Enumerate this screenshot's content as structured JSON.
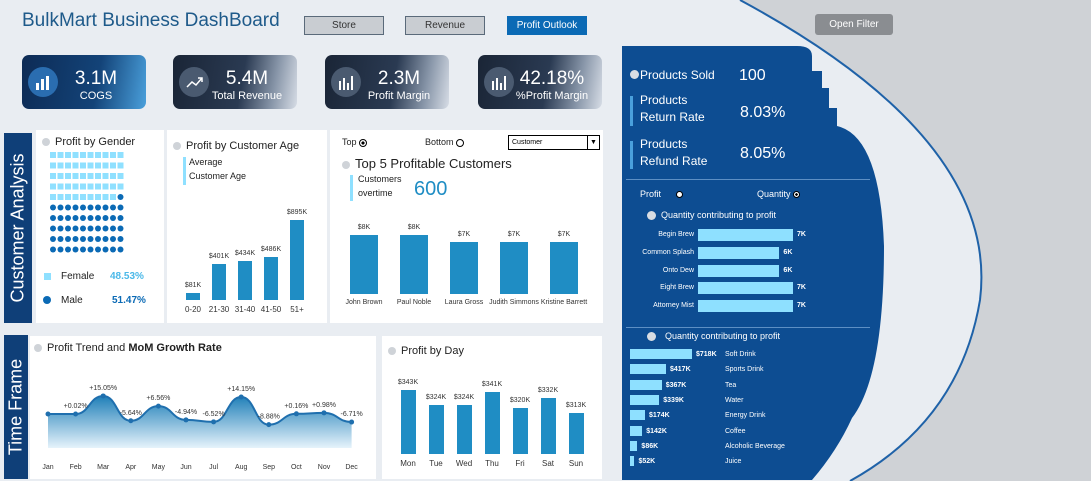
{
  "header": {
    "title": "BulkMart Business DashBoard",
    "tabs": [
      "Store",
      "Revenue",
      "Profit Outlook"
    ],
    "active_tab": "Profit Outlook",
    "open_filter": "Open Filter"
  },
  "kpis": [
    {
      "value": "3.1M",
      "label": "COGS",
      "icon": "bar-chart-icon"
    },
    {
      "value": "5.4M",
      "label": "Total Revenue",
      "icon": "trend-up-icon"
    },
    {
      "value": "2.3M",
      "label": "Profit Margin",
      "icon": "column-chart-icon"
    },
    {
      "value": "42.18%",
      "label": "%Profit Margin",
      "icon": "column-chart-icon"
    }
  ],
  "sections": {
    "customer": "Customer Analysis",
    "time": "Time Frame"
  },
  "gender": {
    "title": "Profit by Gender",
    "female_label": "Female",
    "female_value": "48.53%",
    "male_label": "Male",
    "male_value": "51.47%",
    "female_color": "#8fe0ff",
    "male_color": "#0b6ab5"
  },
  "age": {
    "title": "Profit by Customer Age",
    "avg_label": "Average",
    "avg_label2": "Customer Age"
  },
  "top5": {
    "top_label": "Top",
    "bottom_label": "Bottom",
    "select_value": "Customer",
    "title": "Top 5 Profitable Customers",
    "overtime_label1": "Customers",
    "overtime_label2": "overtime",
    "overtime_value": "600"
  },
  "trend": {
    "title_a": "Profit Trend and ",
    "title_b": "MoM Growth Rate"
  },
  "day": {
    "title": "Profit by Day"
  },
  "right": {
    "products_sold_label": "Products Sold",
    "products_sold_value": "100",
    "return_label1": "Products",
    "return_label2": "Return Rate",
    "return_value": "8.03%",
    "refund_label1": "Products",
    "refund_label2": "Refund Rate",
    "refund_value": "8.05%",
    "toggle_profit": "Profit",
    "toggle_quantity": "Quantity",
    "q1_title": "Quantity contributing to profit",
    "q2_title": "Quantity contributing to profit"
  },
  "chart_data": [
    {
      "type": "bar",
      "id": "age",
      "title": "Profit by Customer Age",
      "categories": [
        "0-20",
        "21-30",
        "31-40",
        "41-50",
        "51+"
      ],
      "values": [
        81,
        401,
        434,
        486,
        895
      ],
      "labels": [
        "$81K",
        "$401K",
        "$434K",
        "$486K",
        "$895K"
      ],
      "ylim": [
        0,
        895
      ]
    },
    {
      "type": "bar",
      "id": "customers",
      "title": "Top 5 Profitable Customers",
      "categories": [
        "John Brown",
        "Paul Noble",
        "Laura Gross",
        "Judith Simmons",
        "Kristine Barrett"
      ],
      "values": [
        8,
        8,
        7,
        7,
        7
      ],
      "labels": [
        "$8K",
        "$8K",
        "$7K",
        "$7K",
        "$7K"
      ],
      "ylim": [
        0,
        8
      ]
    },
    {
      "type": "area",
      "id": "trend",
      "title": "Profit Trend and MoM Growth Rate",
      "categories": [
        "Jan",
        "Feb",
        "Mar",
        "Apr",
        "May",
        "Jun",
        "Jul",
        "Aug",
        "Sep",
        "Oct",
        "Nov",
        "Dec"
      ],
      "values": [
        0.0,
        0.02,
        15.05,
        -5.64,
        6.56,
        -4.94,
        -6.52,
        14.15,
        -8.88,
        0.16,
        0.98,
        -6.71
      ],
      "labels": [
        "",
        "+0.02%",
        "+15.05%",
        "-5.64%",
        "+6.56%",
        "-4.94%",
        "-6.52%",
        "+14.15%",
        "-8.88%",
        "+0.16%",
        "+0.98%",
        "-6.71%"
      ]
    },
    {
      "type": "bar",
      "id": "day",
      "title": "Profit by Day",
      "categories": [
        "Mon",
        "Tue",
        "Wed",
        "Thu",
        "Fri",
        "Sat",
        "Sun"
      ],
      "values": [
        343,
        324,
        324,
        341,
        320,
        332,
        313
      ],
      "labels": [
        "$343K",
        "$324K",
        "$324K",
        "$341K",
        "$320K",
        "$332K",
        "$313K"
      ],
      "ylim": [
        260,
        343
      ]
    },
    {
      "type": "bar",
      "id": "q1",
      "title": "Quantity contributing to profit",
      "categories": [
        "Begin Brew",
        "Common Splash",
        "Onto Dew",
        "Eight Brew",
        "Attorney Mist"
      ],
      "values": [
        7,
        6,
        6,
        7,
        7
      ],
      "labels": [
        "7K",
        "6K",
        "6K",
        "7K",
        "7K"
      ]
    },
    {
      "type": "bar",
      "id": "q2",
      "title": "Quantity contributing to profit",
      "categories": [
        "Soft Drink",
        "Sports Drink",
        "Tea",
        "Water",
        "Energy Drink",
        "Coffee",
        "Alcoholic Beverage",
        "Juice"
      ],
      "values": [
        718,
        417,
        367,
        339,
        174,
        142,
        86,
        52
      ],
      "labels": [
        "$718K",
        "$417K",
        "$367K",
        "$339K",
        "$174K",
        "$142K",
        "$86K",
        "$52K"
      ]
    }
  ]
}
